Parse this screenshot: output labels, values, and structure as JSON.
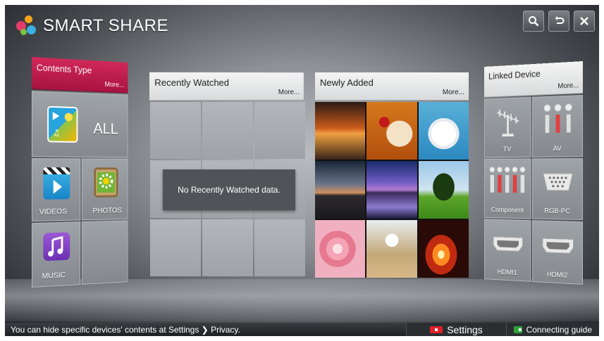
{
  "header": {
    "title": "SMART SHARE",
    "icons": {
      "logo": "smart-share-logo",
      "search": "search-icon",
      "back": "back-icon",
      "close": "close-icon"
    }
  },
  "contents_type": {
    "title": "Contents Type",
    "more": "More...",
    "items": {
      "all": "ALL",
      "videos": "VIDEOS",
      "photos": "PHOTOS",
      "music": "MUSIC"
    }
  },
  "recently_watched": {
    "title": "Recently Watched",
    "more": "More...",
    "empty_message": "No Recently Watched data."
  },
  "newly_added": {
    "title": "Newly Added",
    "more": "More...",
    "thumbnails": [
      "sunset-lake",
      "dog-with-rose",
      "white-kitten",
      "city-skyline",
      "purple-sky-lake",
      "green-tree",
      "pink-rose",
      "dandelion",
      "lava-glow"
    ]
  },
  "linked_device": {
    "title": "Linked Device",
    "more": "More...",
    "devices": {
      "tv": "TV",
      "av": "AV",
      "component": "Component",
      "rgb_pc": "RGB-PC",
      "hdmi1": "HDMI1",
      "hdmi2": "HDMI2"
    }
  },
  "bottom_bar": {
    "hint": "You can hide specific devices' contents at Settings ❯ Privacy.",
    "settings_label": "Settings",
    "guide_label": "Connecting guide",
    "colors": {
      "settings_key": "#e0202a",
      "guide_key": "#2ea33a"
    }
  },
  "colors": {
    "accent": "#c01f4e"
  }
}
